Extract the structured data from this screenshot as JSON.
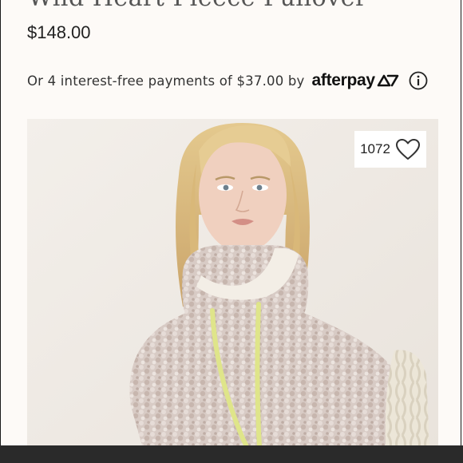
{
  "product": {
    "title": "Wild Heart Fleece Pullover",
    "price": "$148.00"
  },
  "afterpay": {
    "text": "Or 4 interest-free payments of $37.00 by",
    "brand": "afterpay",
    "logo_icon": "afterpay-arrows-icon",
    "info_icon": "info-icon"
  },
  "image": {
    "description": "model wearing fleece pullover",
    "favorite": {
      "count": "1072",
      "icon": "heart-outline-icon"
    }
  },
  "colors": {
    "background": "#fdfaf7",
    "text": "#222222",
    "bottom_bar": "#2a2a2a",
    "fleece": "#d6c8c2",
    "drawstring": "#dfe58a"
  }
}
